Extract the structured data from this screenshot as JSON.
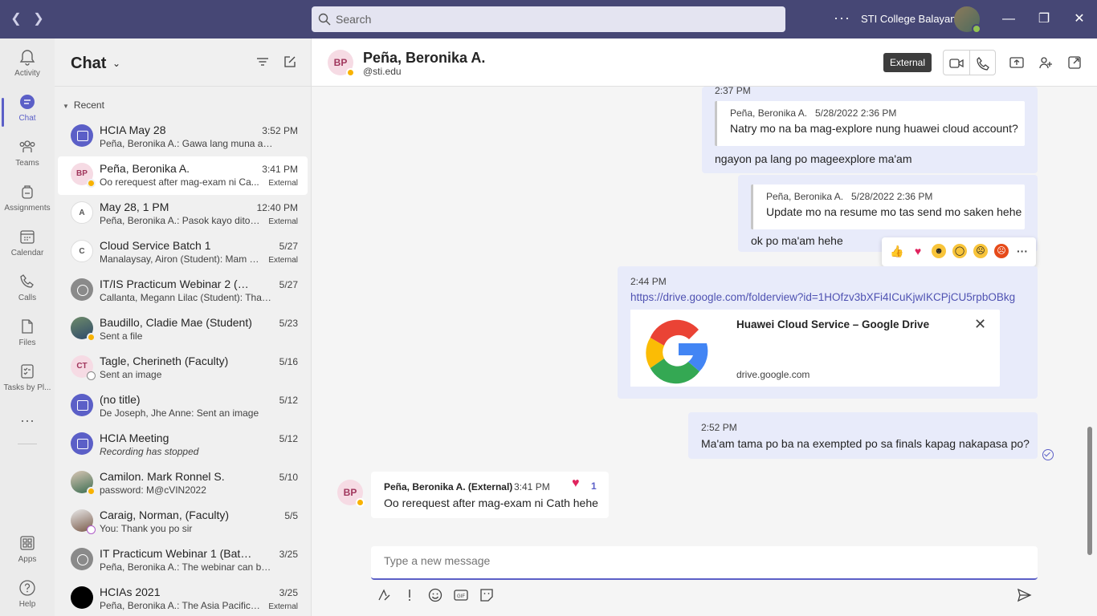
{
  "titlebar": {
    "search_placeholder": "Search",
    "org_name": "STI College Balayan",
    "more": "···"
  },
  "rail": [
    {
      "label": "Activity",
      "icon": "bell-icon"
    },
    {
      "label": "Chat",
      "icon": "chat-icon",
      "active": true
    },
    {
      "label": "Teams",
      "icon": "teams-icon"
    },
    {
      "label": "Assignments",
      "icon": "backpack-icon"
    },
    {
      "label": "Calendar",
      "icon": "calendar-icon"
    },
    {
      "label": "Calls",
      "icon": "phone-icon"
    },
    {
      "label": "Files",
      "icon": "file-icon"
    },
    {
      "label": "Tasks by Pl...",
      "icon": "tasks-icon"
    },
    {
      "label": "···",
      "icon": "more-icon"
    },
    {
      "label": "Apps",
      "icon": "apps-icon"
    },
    {
      "label": "Help",
      "icon": "help-icon"
    }
  ],
  "chatlist": {
    "title": "Chat",
    "section": "Recent",
    "items": [
      {
        "name": "HCIA May 28",
        "time": "3:52 PM",
        "preview": "Peña, Beronika A.: Gawa lang muna ako...",
        "ext": ""
      },
      {
        "name": "Peña, Beronika A.",
        "time": "3:41 PM",
        "preview": "Oo rerequest after mag-exam ni Ca...",
        "ext": "External",
        "initials": "BP"
      },
      {
        "name": "May 28, 1 PM",
        "time": "12:40 PM",
        "preview": "Peña, Beronika A.: Pasok kayo dito h...",
        "ext": "External"
      },
      {
        "name": "Cloud Service Batch 1",
        "time": "5/27",
        "preview": "Manalaysay, Airon (Student): Mam a...",
        "ext": "External"
      },
      {
        "name": "IT/IS Practicum Webinar 2 (Batch...",
        "time": "5/27",
        "preview": "Callanta, Megann Lilac (Student): Thank y...",
        "ext": ""
      },
      {
        "name": "Baudillo, Cladie Mae (Student)",
        "time": "5/23",
        "preview": "Sent a file",
        "ext": ""
      },
      {
        "name": "Tagle, Cherineth (Faculty)",
        "time": "5/16",
        "preview": "Sent an image",
        "ext": "",
        "initials": "CT"
      },
      {
        "name": "(no title)",
        "time": "5/12",
        "preview": "De Joseph, Jhe Anne: Sent an image",
        "ext": ""
      },
      {
        "name": "HCIA Meeting",
        "time": "5/12",
        "preview": "Recording has stopped",
        "ext": ""
      },
      {
        "name": "Camilon. Mark Ronnel S.",
        "time": "5/10",
        "preview": "password: M@cVIN2022",
        "ext": ""
      },
      {
        "name": "Caraig, Norman, (Faculty)",
        "time": "5/5",
        "preview": "You: Thank you po sir",
        "ext": ""
      },
      {
        "name": "IT Practicum Webinar 1 (Batch 1)",
        "time": "3/25",
        "preview": "Peña, Beronika A.: The webinar can be ac...",
        "ext": ""
      },
      {
        "name": "HCIAs 2021",
        "time": "3/25",
        "preview": "Peña, Beronika A.: The Asia Pacific W...",
        "ext": "External"
      }
    ]
  },
  "conversation": {
    "name": "Peña, Beronika A.",
    "email": "@sti.edu",
    "initials": "BP",
    "external_tag": "External",
    "messages": {
      "m1_time": "2:37 PM",
      "m1_quote_author": "Peña, Beronika A.",
      "m1_quote_date": "5/28/2022 2:36 PM",
      "m1_quote_text": "Natry mo na ba mag-explore nung huawei cloud account?",
      "m1_text": "ngayon pa lang po mageexplore ma'am",
      "m2_quote_author": "Peña, Beronika A.",
      "m2_quote_date": "5/28/2022 2:36 PM",
      "m2_quote_text": "Update mo na resume mo tas send mo saken hehe",
      "m2_text": "ok po ma'am hehe",
      "m3_time": "2:44 PM",
      "m3_link": "https://drive.google.com/folderview?id=1HOfzv3bXFi4ICuKjwIKCPjCU5rpbOBkg",
      "m3_card_title": "Huawei Cloud Service – Google Drive",
      "m3_card_domain": "drive.google.com",
      "m4_time": "2:52 PM",
      "m4_text": "Ma'am tama po ba na exempted po sa finals kapag nakapasa po?",
      "m5_author": "Peña, Beronika A. (External)",
      "m5_time": "3:41 PM",
      "m5_text": "Oo rerequest after mag-exam ni Cath hehe",
      "m5_reaction_count": "1"
    },
    "compose_placeholder": "Type a new message"
  }
}
